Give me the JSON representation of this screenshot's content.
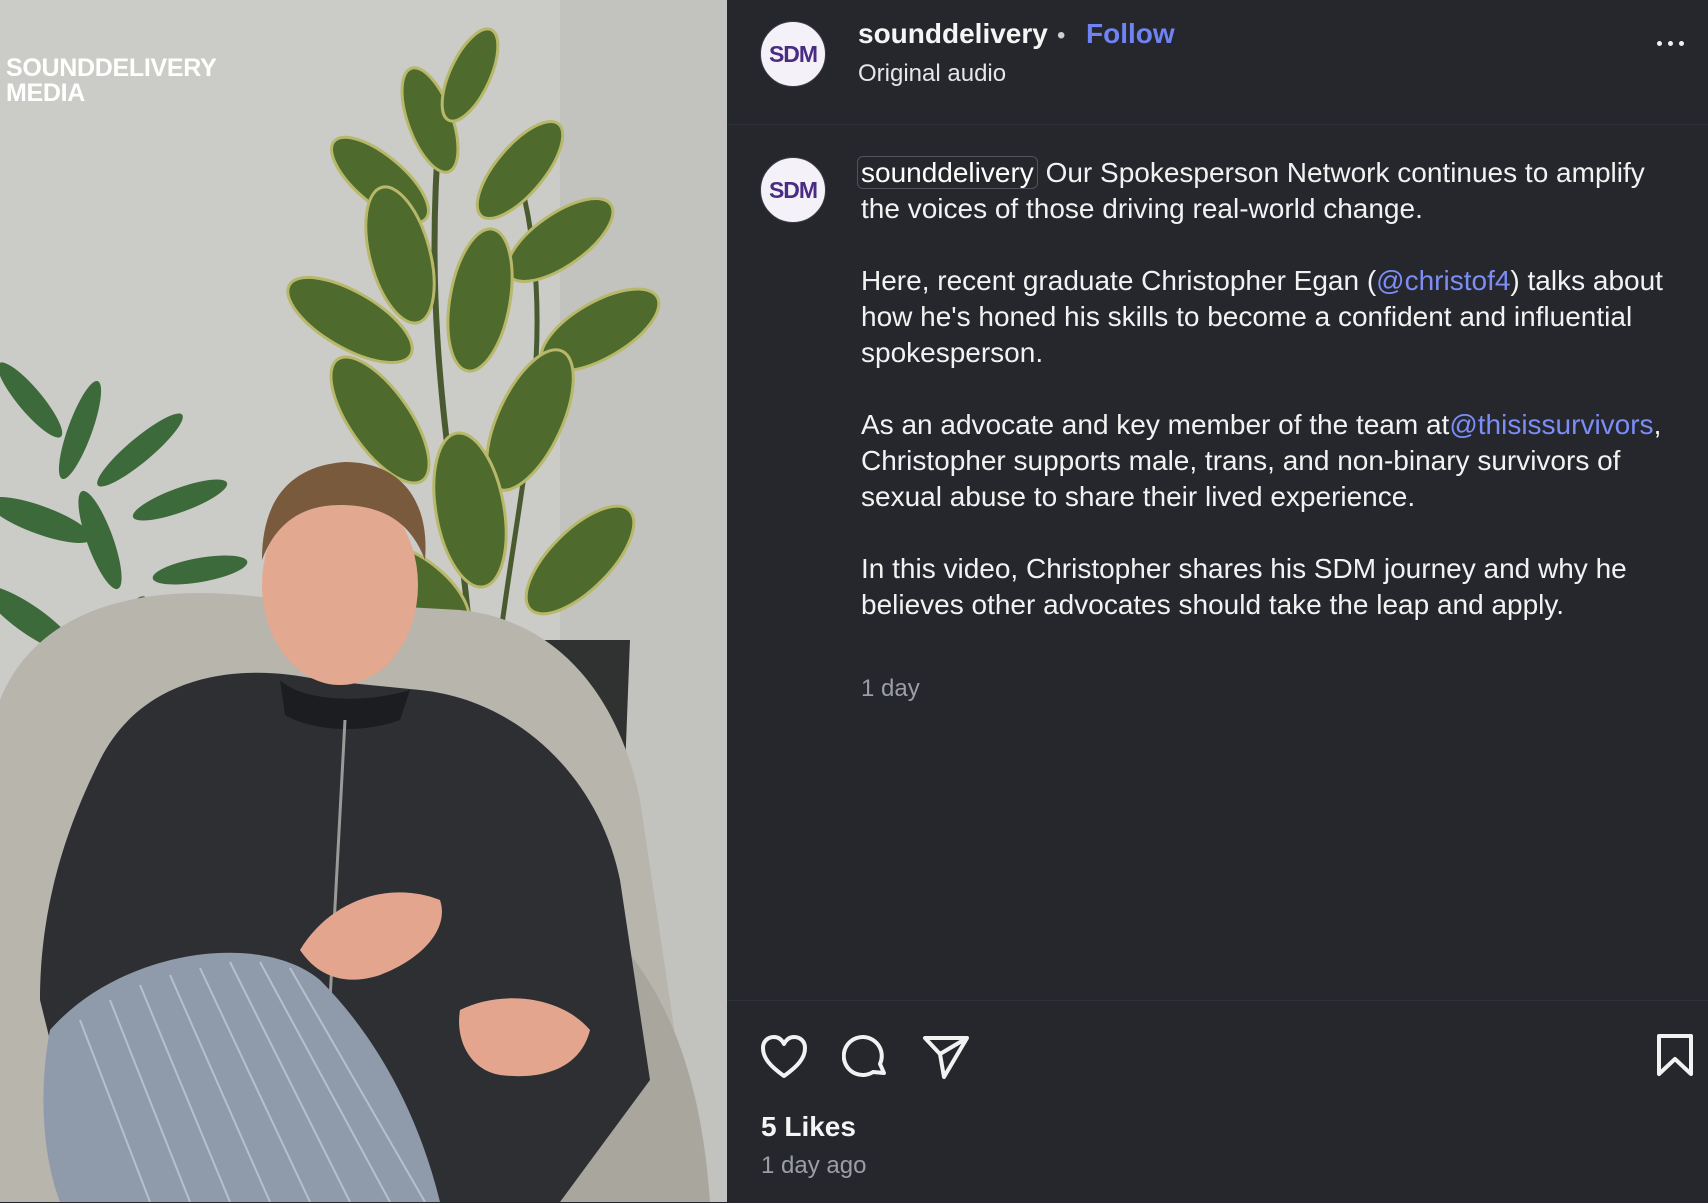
{
  "video": {
    "watermark_line1": "SOUNDDELIVERY",
    "watermark_line2": "MEDIA"
  },
  "header": {
    "avatar_text": "SDM",
    "username": "sounddelivery",
    "separator": "•",
    "follow_label": "Follow",
    "audio": "Original audio",
    "more_icon": "more-horizontal-icon"
  },
  "caption": {
    "avatar_text": "SDM",
    "username": "sounddelivery",
    "p1": "Our Spokesperson Network continues to amplify the voices of those driving real-world change.",
    "p2_before": "Here, recent graduate Christopher Egan (",
    "p2_mention": "@christof4",
    "p2_after": ") talks about how he's honed his skills to become a confident and influential spokesperson.",
    "p3_before": "As an advocate and key member of the team at",
    "p3_mention": "@thisissurvivors",
    "p3_after": ", Christopher supports male, trans, and non-binary survivors of sexual abuse to share their lived experience.",
    "p4": "In this video, Christopher shares his SDM journey and why he believes other advocates should take the leap and apply.",
    "time": "1 day"
  },
  "actions": {
    "icons": [
      "heart-icon",
      "comment-icon",
      "share-icon",
      "bookmark-icon"
    ],
    "likes": "5 Likes",
    "posted": "1 day ago"
  },
  "colors": {
    "background": "#25272d",
    "link": "#6f83f5",
    "avatar_text": "#4a2d82"
  }
}
